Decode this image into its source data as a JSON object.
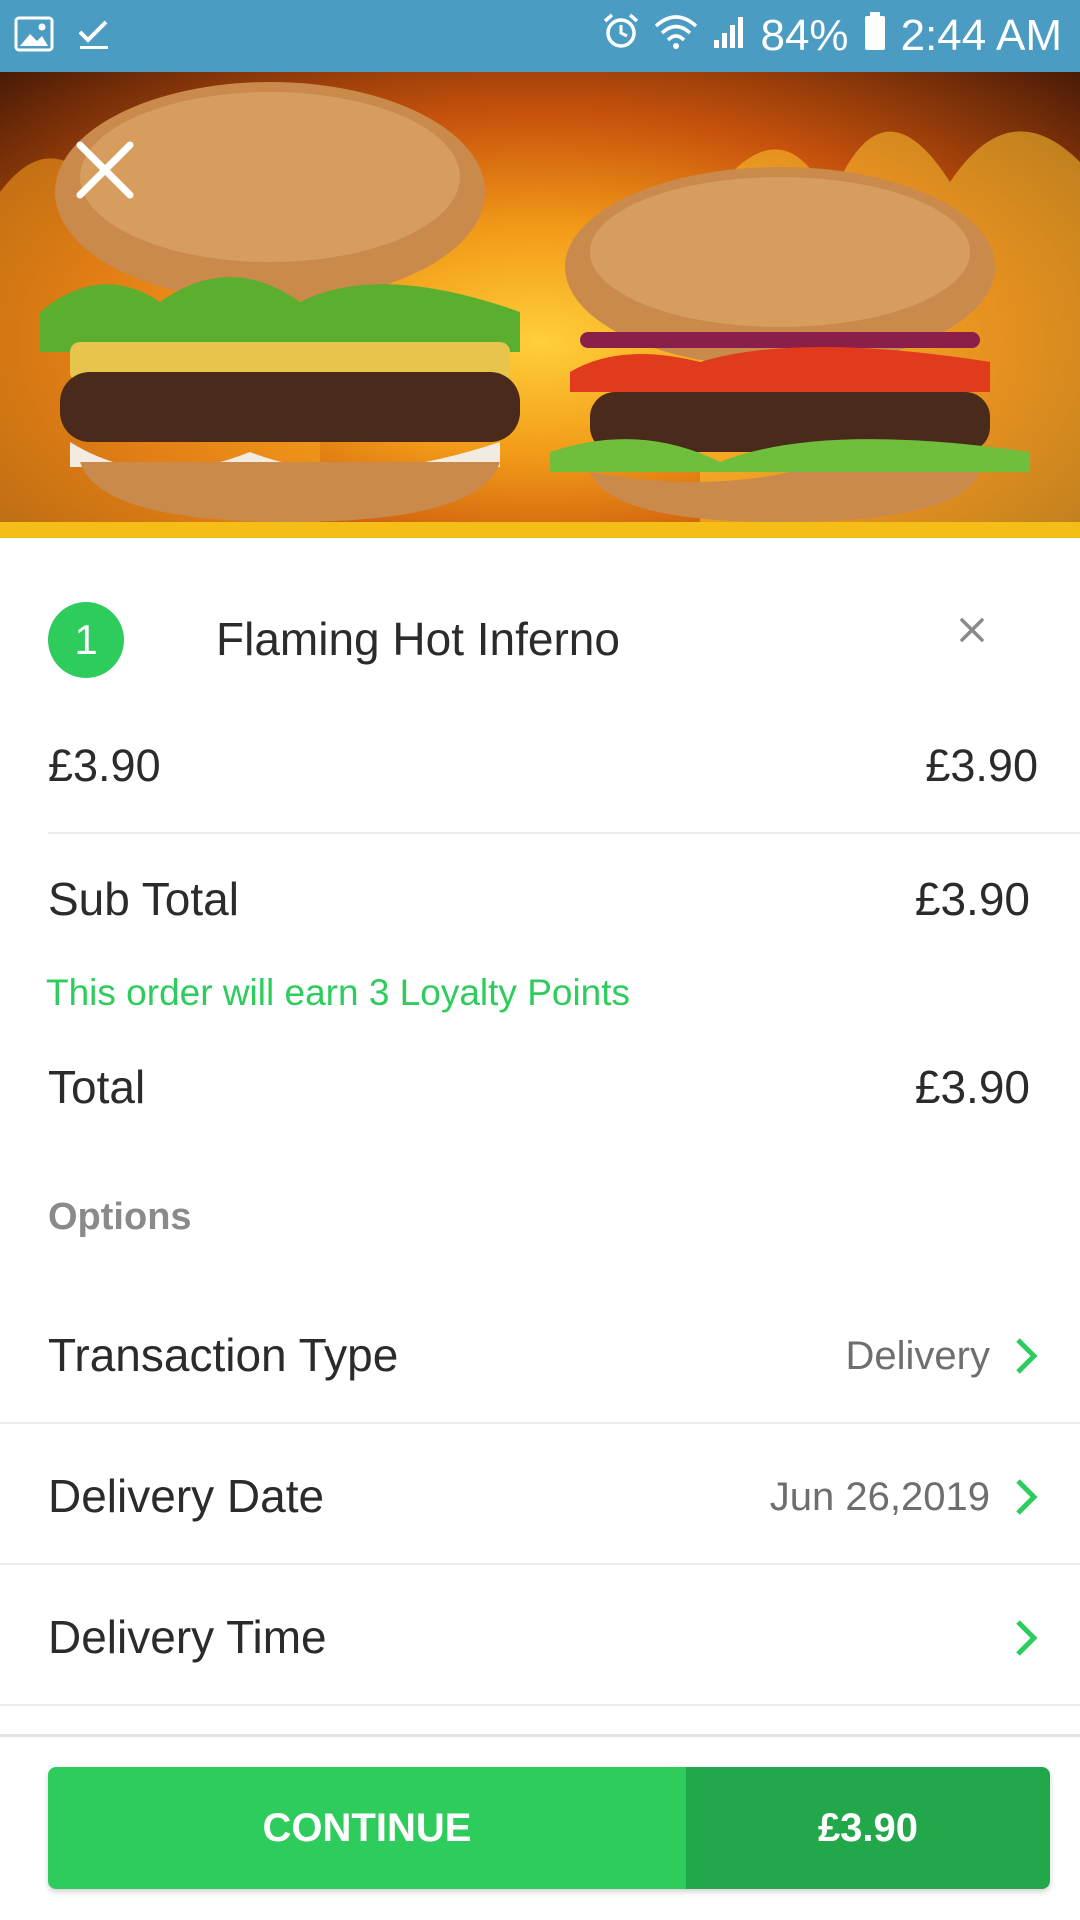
{
  "status_bar": {
    "battery": "84%",
    "time": "2:44 AM"
  },
  "hero": {
    "image": "burgers-on-fire-photo"
  },
  "item": {
    "quantity": "1",
    "name": "Flaming Hot Inferno",
    "unit_price": "£3.90",
    "line_total": "£3.90"
  },
  "summary": {
    "sub_total_label": "Sub Total",
    "sub_total_value": "£3.90",
    "loyalty_text": "This order will earn 3 Loyalty Points",
    "total_label": "Total",
    "total_value": "£3.90"
  },
  "options": {
    "header": "Options",
    "rows": [
      {
        "label": "Transaction Type",
        "value": "Delivery"
      },
      {
        "label": "Delivery Date",
        "value": "Jun 26,2019"
      },
      {
        "label": "Delivery Time",
        "value": ""
      }
    ]
  },
  "cta": {
    "continue_label": "CONTINUE",
    "price": "£3.90"
  },
  "colors": {
    "status_bar": "#4b9cc3",
    "accent_green": "#2ecc5d",
    "dark_green": "#22a84a",
    "stripe_yellow": "#f5be17"
  }
}
